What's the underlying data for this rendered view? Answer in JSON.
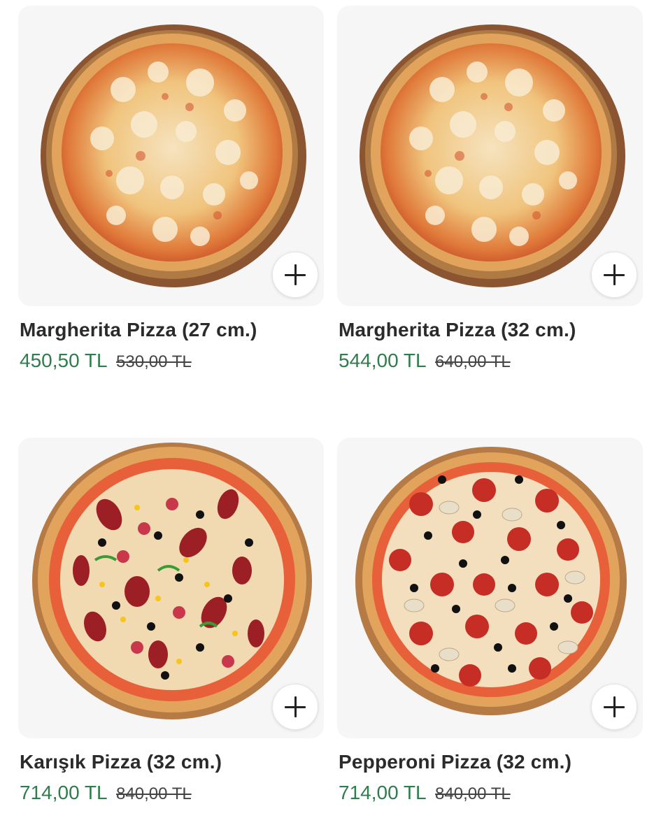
{
  "products": [
    {
      "name": "Margherita Pizza (27 cm.)",
      "price": "450,50 TL",
      "old_price": "530,00 TL",
      "image": "margherita-pizza-image",
      "add_icon": "plus-icon"
    },
    {
      "name": "Margherita Pizza (32 cm.)",
      "price": "544,00 TL",
      "old_price": "640,00 TL",
      "image": "margherita-pizza-image",
      "add_icon": "plus-icon"
    },
    {
      "name": "Karışık Pizza (32 cm.)",
      "price": "714,00 TL",
      "old_price": "840,00 TL",
      "image": "mixed-pizza-image",
      "add_icon": "plus-icon"
    },
    {
      "name": "Pepperoni Pizza (32 cm.)",
      "price": "714,00 TL",
      "old_price": "840,00 TL",
      "image": "pepperoni-pizza-image",
      "add_icon": "plus-icon"
    }
  ],
  "colors": {
    "price": "#2f7d4c",
    "title": "#2b2b2b",
    "card_bg": "#f6f6f6"
  }
}
